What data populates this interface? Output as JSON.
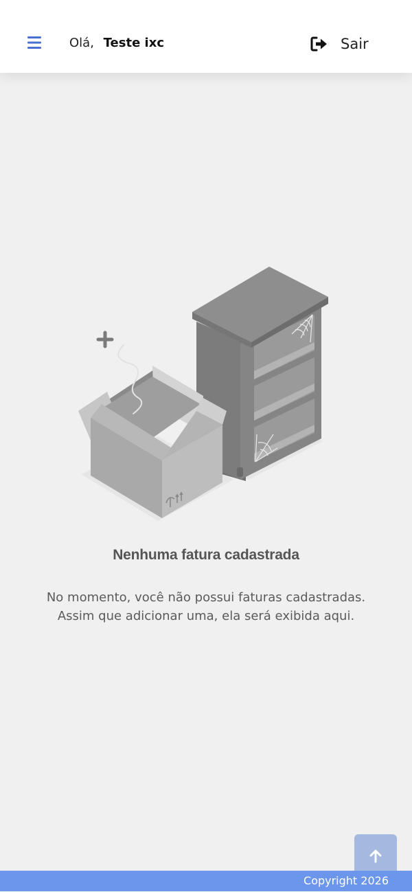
{
  "header": {
    "greeting": "Olá,",
    "user_name": "Teste ixc",
    "logout_label": "Sair",
    "menu_icon": "hamburger-menu-icon",
    "logout_icon": "sign-out-icon",
    "accent_color": "#4a6fd0"
  },
  "empty_state": {
    "illustration": "empty-box-and-shelf-illustration",
    "title": "Nenhuma fatura cadastrada",
    "description_line1": "No momento, você não possui faturas cadastradas.",
    "description_line2": "Assim que adicionar uma, ela será exibida aqui."
  },
  "scroll_top": {
    "icon": "arrow-up-icon",
    "color": "#a4b8e0"
  },
  "footer": {
    "copyright": "Copyright 2026",
    "color": "#6b96ec"
  }
}
